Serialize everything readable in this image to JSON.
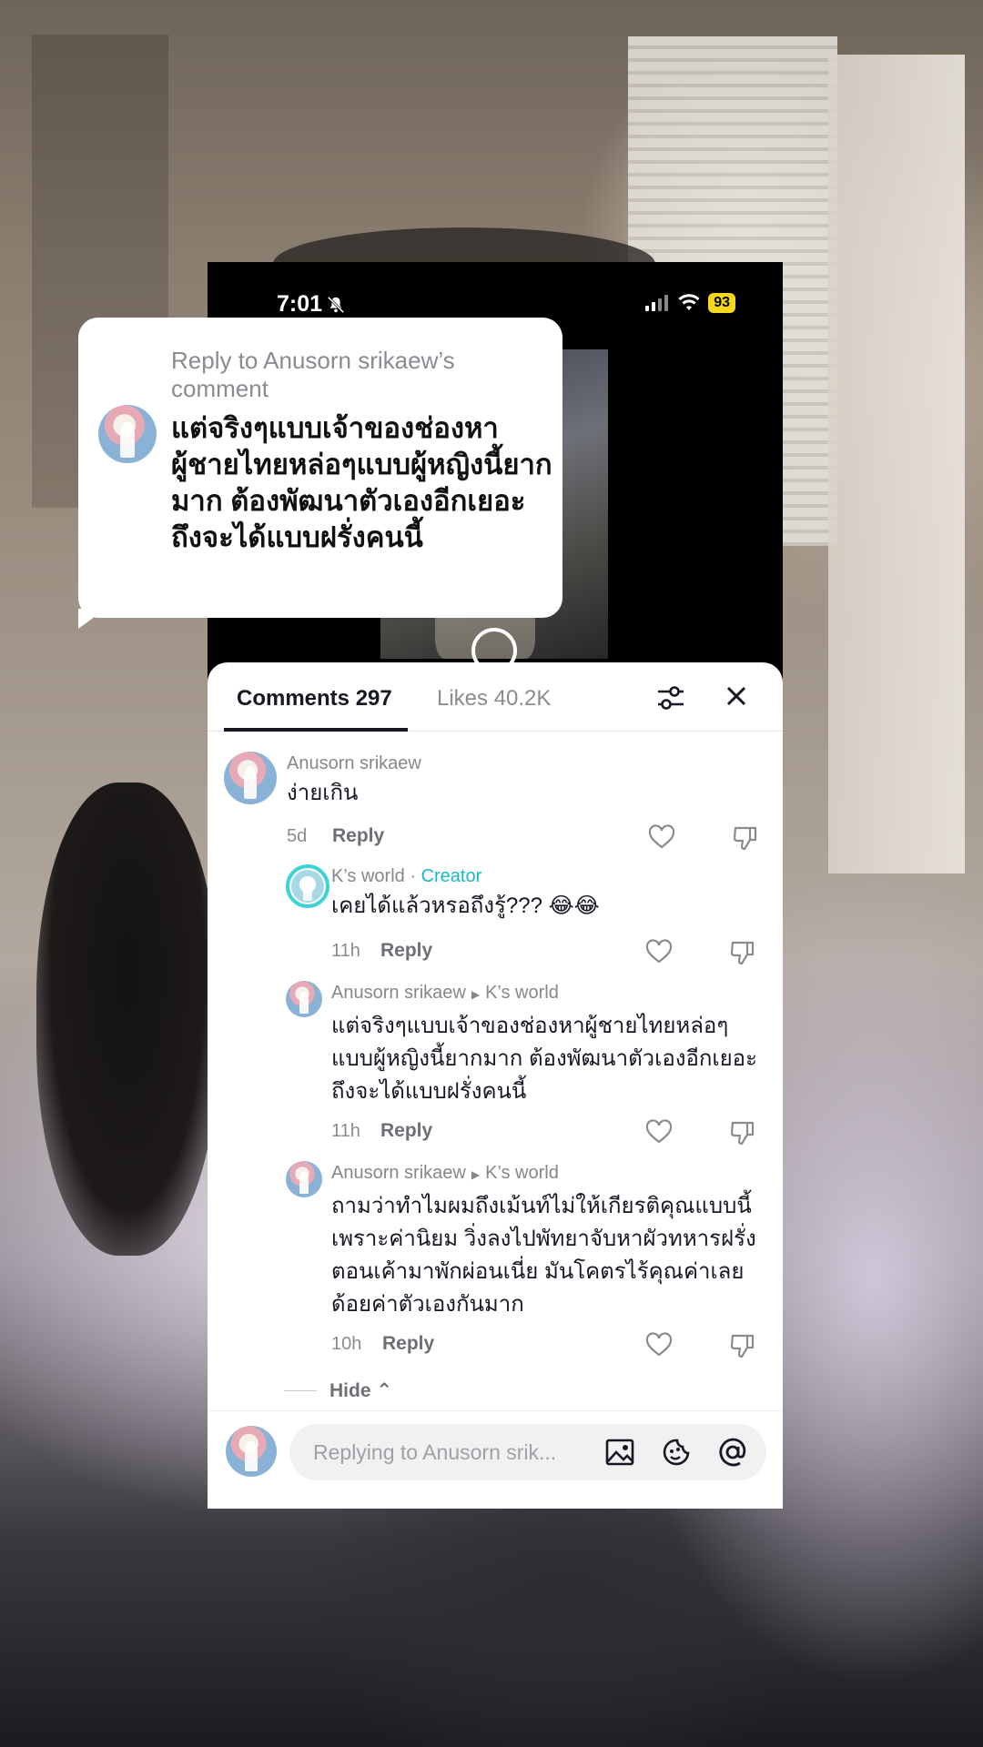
{
  "status": {
    "time": "7:01",
    "battery": "93"
  },
  "bubble": {
    "title": "Reply to Anusorn srikaew’s comment",
    "text": "แต่จริงๆแบบเจ้าของช่องหาผู้ชายไทยหล่อๆแบบผู้หญิงนี้ยากมาก ต้องพัฒนาตัวเองอีกเยอะถึงจะได้แบบฝรั่งคนนี้"
  },
  "tabs": {
    "comments": "Comments 297",
    "likes": "Likes 40.2K"
  },
  "comments": [
    {
      "author": "Anusorn srikaew",
      "text": "ง่ายเกิน",
      "time": "5d",
      "reply": "Reply"
    },
    {
      "author": "K’s world",
      "separator": "·",
      "tag": "Creator",
      "text": "เคยได้แล้วหรอถึงรู้??? 😂😂",
      "time": "11h",
      "reply": "Reply"
    },
    {
      "author": "Anusorn srikaew",
      "reply_to": "K’s world",
      "text": "แต่จริงๆแบบเจ้าของช่องหาผู้ชายไทยหล่อๆแบบผู้หญิงนี้ยากมาก ต้องพัฒนาตัวเองอีกเยอะถึงจะได้แบบฝรั่งคนนี้",
      "time": "11h",
      "reply": "Reply"
    },
    {
      "author": "Anusorn srikaew",
      "reply_to": "K’s world",
      "text": "ถามว่าทำไมผมถึงเม้นท์ไม่ให้เกียรติคุณแบบนี้ เพราะค่านิยม วิ่งลงไปพัทยาจับหาผัวทหารฝรั่งตอนเค้ามาพักผ่อนเนี่ย มันโคตรไร้คุณค่าเลย ด้อยค่าตัวเองกันมาก",
      "time": "10h",
      "reply": "Reply"
    }
  ],
  "hide_label": "Hide",
  "composer": {
    "placeholder": "Replying to Anusorn srik..."
  },
  "icons": [
    "bell-off-icon",
    "signal-icon",
    "wifi-icon",
    "filter-icon",
    "close-icon",
    "heart-icon",
    "dislike-icon",
    "image-icon",
    "emoji-icon",
    "mention-icon"
  ],
  "colors": {
    "creator": "#19b9c5",
    "battery": "#f4d61a",
    "text": "#161823",
    "muted": "#8a8b91"
  }
}
